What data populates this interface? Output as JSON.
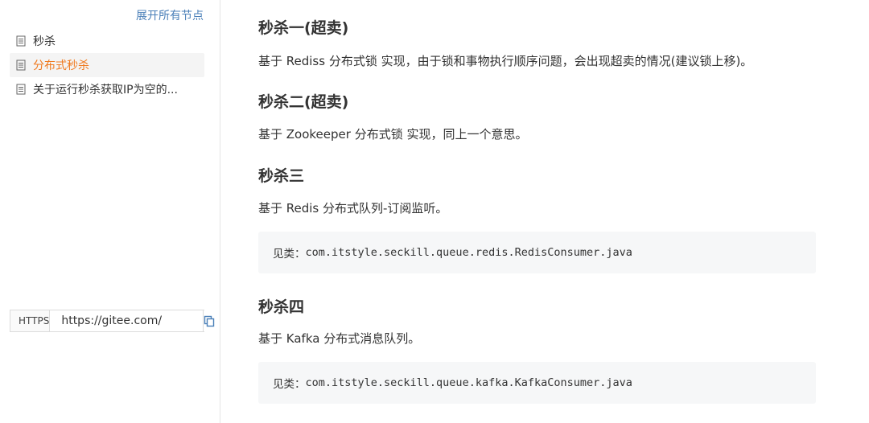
{
  "sidebar": {
    "expand_all": "展开所有节点",
    "items": [
      {
        "label": "秒杀",
        "active": false
      },
      {
        "label": "分布式秒杀",
        "active": true
      },
      {
        "label": "关于运行秒杀获取IP为空的...",
        "active": false
      }
    ],
    "clone": {
      "protocol": "HTTPS",
      "url": "https://gitee.com/"
    }
  },
  "content": {
    "sections": [
      {
        "title": "秒杀一(超卖)",
        "text": "基于 Rediss 分布式锁 实现，由于锁和事物执行顺序问题，会出现超卖的情况(建议锁上移)。"
      },
      {
        "title": "秒杀二(超卖)",
        "text": "基于 Zookeeper 分布式锁 实现，同上一个意思。"
      },
      {
        "title": "秒杀三",
        "text": "基于 Redis 分布式队列-订阅监听。",
        "code_prefix": "见类：",
        "code_path": "com.itstyle.seckill.queue.redis.RedisConsumer.java"
      },
      {
        "title": "秒杀四",
        "text": "基于 Kafka 分布式消息队列。",
        "code_prefix": "见类：",
        "code_path": "com.itstyle.seckill.queue.kafka.KafkaConsumer.java"
      }
    ]
  },
  "colors": {
    "active": "#f0791e",
    "link": "#4a7fb8",
    "code_bg": "#f6f7f8"
  }
}
